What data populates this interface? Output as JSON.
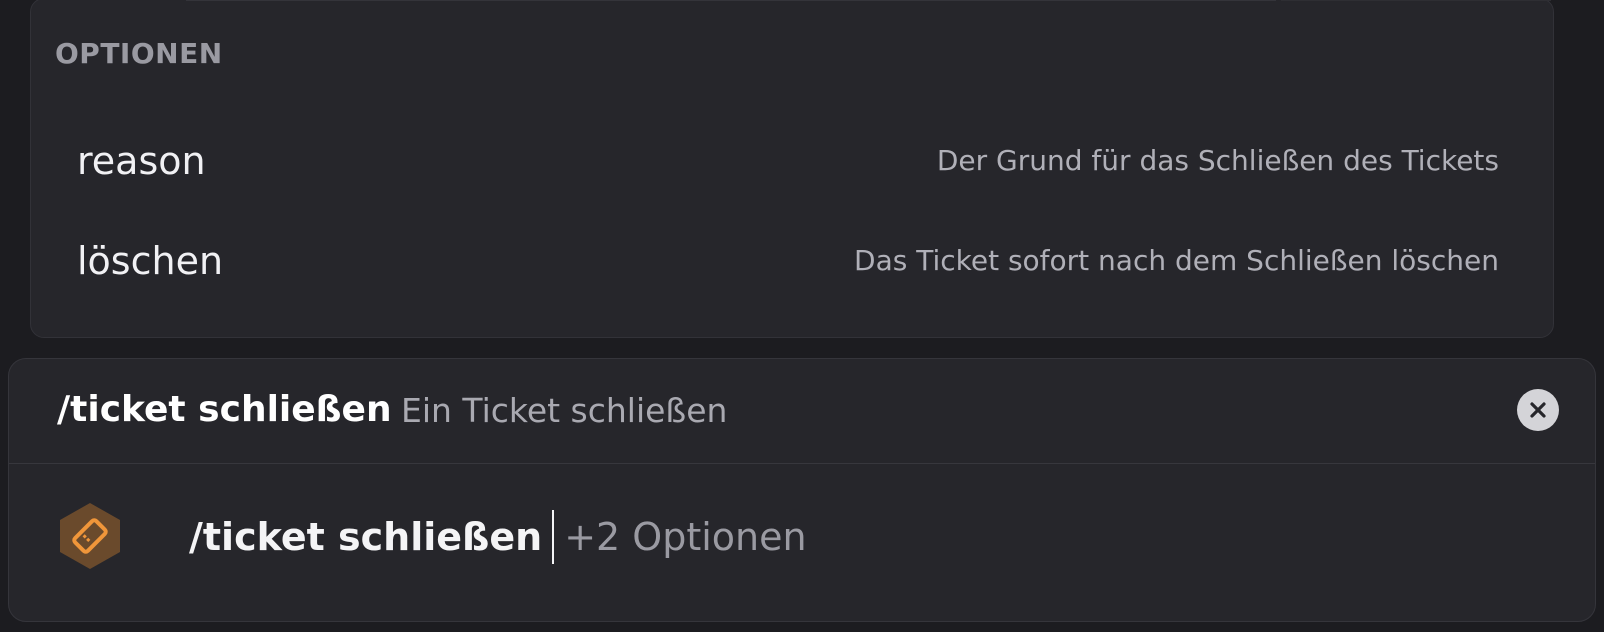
{
  "options": {
    "header": "OPTIONEN",
    "items": [
      {
        "name": "reason",
        "description": "Der Grund für das Schließen des Tickets"
      },
      {
        "name": "löschen",
        "description": "Das Ticket sofort nach dem Schließen löschen"
      }
    ]
  },
  "command": {
    "title": "/ticket schließen",
    "subtitle": "Ein Ticket schließen",
    "input_value": "/ticket schließen",
    "input_hint": "+2 Optionen",
    "app_icon": "ticket-icon",
    "close_icon": "close-icon"
  },
  "colors": {
    "panel": "#26262b",
    "background": "#1c1c20",
    "icon_orange": "#f0963a",
    "icon_bg": "#6a4a2c"
  }
}
